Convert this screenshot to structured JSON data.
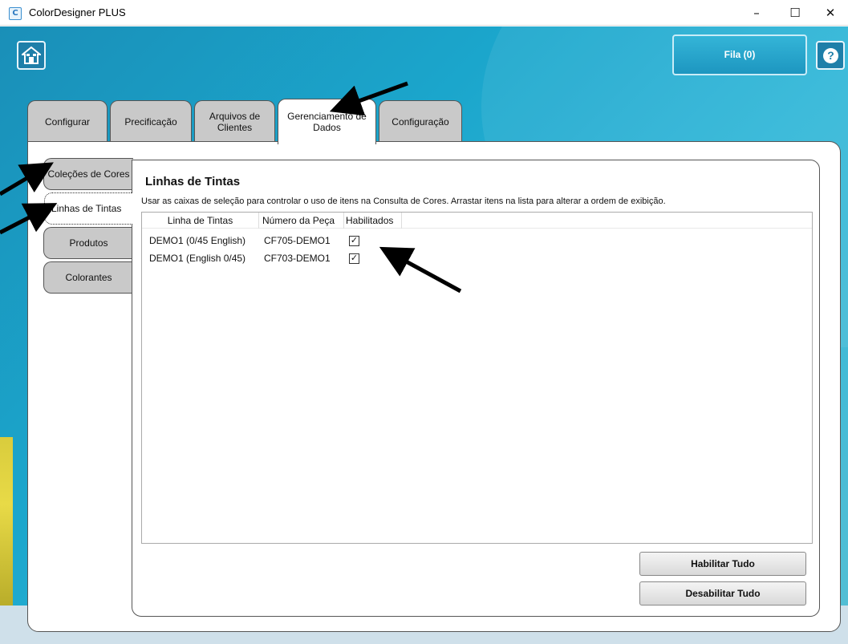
{
  "window": {
    "title": "ColorDesigner PLUS",
    "icon": "app-logo-icon",
    "minimize": "–",
    "maximize": "☐",
    "close": "✕"
  },
  "header": {
    "home_icon": "home-icon",
    "queue_label": "Fila (0)",
    "help_glyph": "?"
  },
  "tabs": [
    {
      "label": "Configurar"
    },
    {
      "label": "Precificação"
    },
    {
      "label": "Arquivos de Clientes"
    },
    {
      "label": "Gerenciamento de Dados",
      "active": true
    },
    {
      "label": "Configuração"
    }
  ],
  "side_tabs": [
    {
      "label": "Coleções de Cores"
    },
    {
      "label": "Linhas de Tintas",
      "active": true
    },
    {
      "label": "Produtos"
    },
    {
      "label": "Colorantes"
    }
  ],
  "content": {
    "title": "Linhas de Tintas",
    "description": "Usar as caixas de seleção para controlar o uso de itens na Consulta de Cores. Arrastar itens na lista para alterar a ordem de exibição.",
    "columns": [
      "Linha de Tintas",
      "Número da Peça",
      "Habilitados"
    ],
    "rows": [
      {
        "line": "DEMO1 (0/45 English)",
        "part": "CF705-DEMO1",
        "enabled": true
      },
      {
        "line": "DEMO1 (English 0/45)",
        "part": "CF703-DEMO1",
        "enabled": true
      }
    ],
    "enable_all": "Habilitar Tudo",
    "disable_all": "Desabilitar Tudo"
  },
  "colors": {
    "background": "#1ba6cc",
    "tab_inactive": "#c9c9c9",
    "panel": "#ffffff",
    "annotation_arrow": "#000000"
  }
}
